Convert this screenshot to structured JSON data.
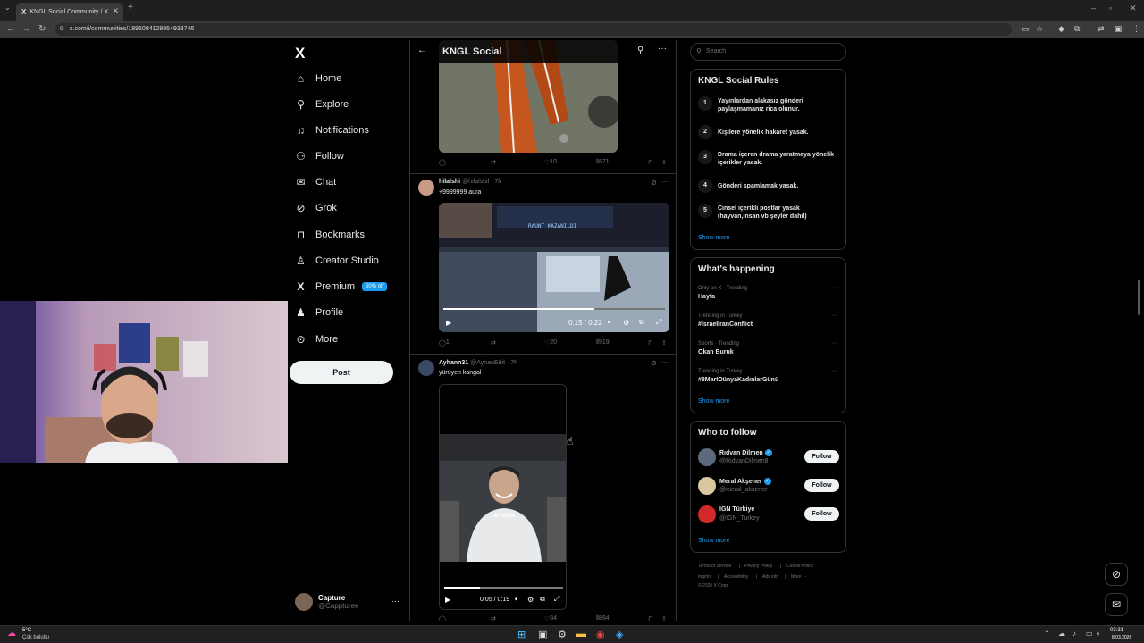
{
  "browser": {
    "tab_title": "KNGL Social Community / X",
    "tab_icon": "X",
    "url": "x.com/i/communities/1895084128954933746"
  },
  "nav": {
    "logo": "X",
    "items": [
      {
        "label": "Home",
        "icon": "home-icon"
      },
      {
        "label": "Explore",
        "icon": "search-icon"
      },
      {
        "label": "Notifications",
        "icon": "bell-icon"
      },
      {
        "label": "Follow",
        "icon": "person-add-icon"
      },
      {
        "label": "Chat",
        "icon": "mail-icon"
      },
      {
        "label": "Grok",
        "icon": "grok-icon"
      },
      {
        "label": "Bookmarks",
        "icon": "bookmark-icon"
      },
      {
        "label": "Creator Studio",
        "icon": "creator-icon"
      },
      {
        "label": "Premium",
        "icon": "x-icon"
      },
      {
        "label": "Profile",
        "icon": "person-icon"
      },
      {
        "label": "More",
        "icon": "more-circle-icon"
      }
    ],
    "premium_badge": "50% off",
    "post_button": "Post",
    "account": {
      "name": "Capture",
      "handle": "@Cappturee"
    }
  },
  "feed": {
    "title": "KNGL Social",
    "posts": [
      {
        "actions": {
          "replies": "",
          "reposts": "",
          "likes": "10",
          "views": "871"
        }
      },
      {
        "name": "hilalshi",
        "handle": "@hilalshil",
        "time": "· 7h",
        "text": "+9999999 aura",
        "video_time": "0:15 / 0:22",
        "video_progress": 0.68,
        "video_overlay": "RAUNT KAZANILDI",
        "actions": {
          "replies": "1",
          "reposts": "",
          "likes": "20",
          "views": "919"
        }
      },
      {
        "name": "Ayhann31",
        "handle": "@AyhanEdit",
        "time": "· 7h",
        "text": "yürüyen kangal",
        "video_time": "0:05 / 0:19",
        "video_progress": 0.3,
        "video_overlay": "AYHAN",
        "actions": {
          "replies": "",
          "reposts": "",
          "likes": "34",
          "views": "894"
        }
      }
    ]
  },
  "sidebar": {
    "search_placeholder": "Search",
    "rules": {
      "title": "KNGL Social Rules",
      "items": [
        {
          "num": "1",
          "text": "Yayınlardan alakasız gönderi paylaşmamanız rica olunur."
        },
        {
          "num": "2",
          "text": "Kişilere yönelik hakaret yasak."
        },
        {
          "num": "3",
          "text": "Drama içeren drama yaratmaya yönelik içerikler yasak."
        },
        {
          "num": "4",
          "text": "Gönderi spamlamak yasak."
        },
        {
          "num": "5",
          "text": "Cinsel içerikli postlar yasak (hayvan,insan vb şeyler dahil)"
        }
      ],
      "show_more": "Show more"
    },
    "happening": {
      "title": "What's happening",
      "items": [
        {
          "meta": "Only on X · Trending",
          "name": "Hayfa"
        },
        {
          "meta": "Trending in Turkey",
          "name": "#IsraelIranConflict"
        },
        {
          "meta": "Sports · Trending",
          "name": "Okan Buruk"
        },
        {
          "meta": "Trending in Turkey",
          "name": "#8MartDünyaKadınlarGünü"
        }
      ],
      "show_more": "Show more"
    },
    "who_to_follow": {
      "title": "Who to follow",
      "items": [
        {
          "name": "Rıdvan Dilmen",
          "handle": "@RidvanDilmen8",
          "verified": true,
          "button": "Follow"
        },
        {
          "name": "Meral Akşener",
          "handle": "@meral_aksener",
          "verified": true,
          "button": "Follow"
        },
        {
          "name": "IGN Türkiye",
          "handle": "@IGN_Turkey",
          "verified": false,
          "button": "Follow"
        }
      ],
      "show_more": "Show more"
    },
    "footer": {
      "links": [
        "Terms of Service",
        "|",
        "Privacy Policy",
        "|",
        "Cookie Policy",
        "|",
        "Imprint",
        "|",
        "Accessibility",
        "|",
        "Ads info",
        "|",
        "More ···"
      ],
      "copyright": "© 2026 X Corp."
    }
  },
  "taskbar": {
    "weather_temp": "5°C",
    "weather_desc": "Çok bulutlu",
    "time": "03:31",
    "date": "8.03.2026"
  },
  "colors": {
    "accent": "#1d9bf0",
    "background": "#000000",
    "border": "#2f3336",
    "text_secondary": "#71767b"
  }
}
